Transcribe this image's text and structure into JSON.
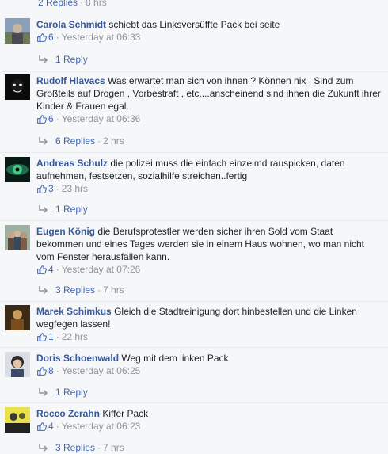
{
  "top_reply": {
    "label": "2 Replies",
    "time": "8 hrs"
  },
  "comments": [
    {
      "author": "Carola Schmidt",
      "text": "schiebt das Linksversüffte Pack bei seite",
      "likes": "6",
      "time": "Yesterday at 06:33",
      "replies": "1 Reply",
      "replies_time": ""
    },
    {
      "author": "Rudolf Hlavacs",
      "text": "Was erwartet man sich von ihnen ? Können nix , Sind zum Großteils auf Drogen , Vorbestraft , etc....anscheinend sind ihnen die Zukunft ihrer Kinder & Frauen egal.",
      "likes": "6",
      "time": "Yesterday at 06:36",
      "replies": "6 Replies",
      "replies_time": "2 hrs"
    },
    {
      "author": "Andreas Schulz",
      "text": "die polizei muss die einfach einzelmd rauspicken, daten aufnehmen, festsetzen, sozialhilfe streichen..fertig",
      "likes": "3",
      "time": "23 hrs",
      "replies": "1 Reply",
      "replies_time": ""
    },
    {
      "author": "Eugen König",
      "text": "die Berufsprotestler werden sicher ihren Sold vom Staat bekommen und eines Tages werden sie in einem Haus wohnen, wo man nicht vom Fenster herausfallen kann.",
      "likes": "4",
      "time": "Yesterday at 07:26",
      "replies": "3 Replies",
      "replies_time": "7 hrs"
    },
    {
      "author": "Marek Schimkus",
      "text": "Gleich die Stadtreinigung dort hinbestellen und die Linken wegfegen lassen!",
      "likes": "1",
      "time": "22 hrs",
      "replies": "",
      "replies_time": ""
    },
    {
      "author": "Doris Schoenwald",
      "text": "Weg mit dem linken Pack",
      "likes": "8",
      "time": "Yesterday at 06:25",
      "replies": "1 Reply",
      "replies_time": ""
    },
    {
      "author": "Rocco Zerahn",
      "text": "Kiffer Pack",
      "likes": "4",
      "time": "Yesterday at 06:23",
      "replies": "3 Replies",
      "replies_time": "7 hrs"
    }
  ],
  "colors": {
    "link": "#4267b2",
    "author": "#365899",
    "meta": "#90949c",
    "background": "#f6f7f9"
  }
}
